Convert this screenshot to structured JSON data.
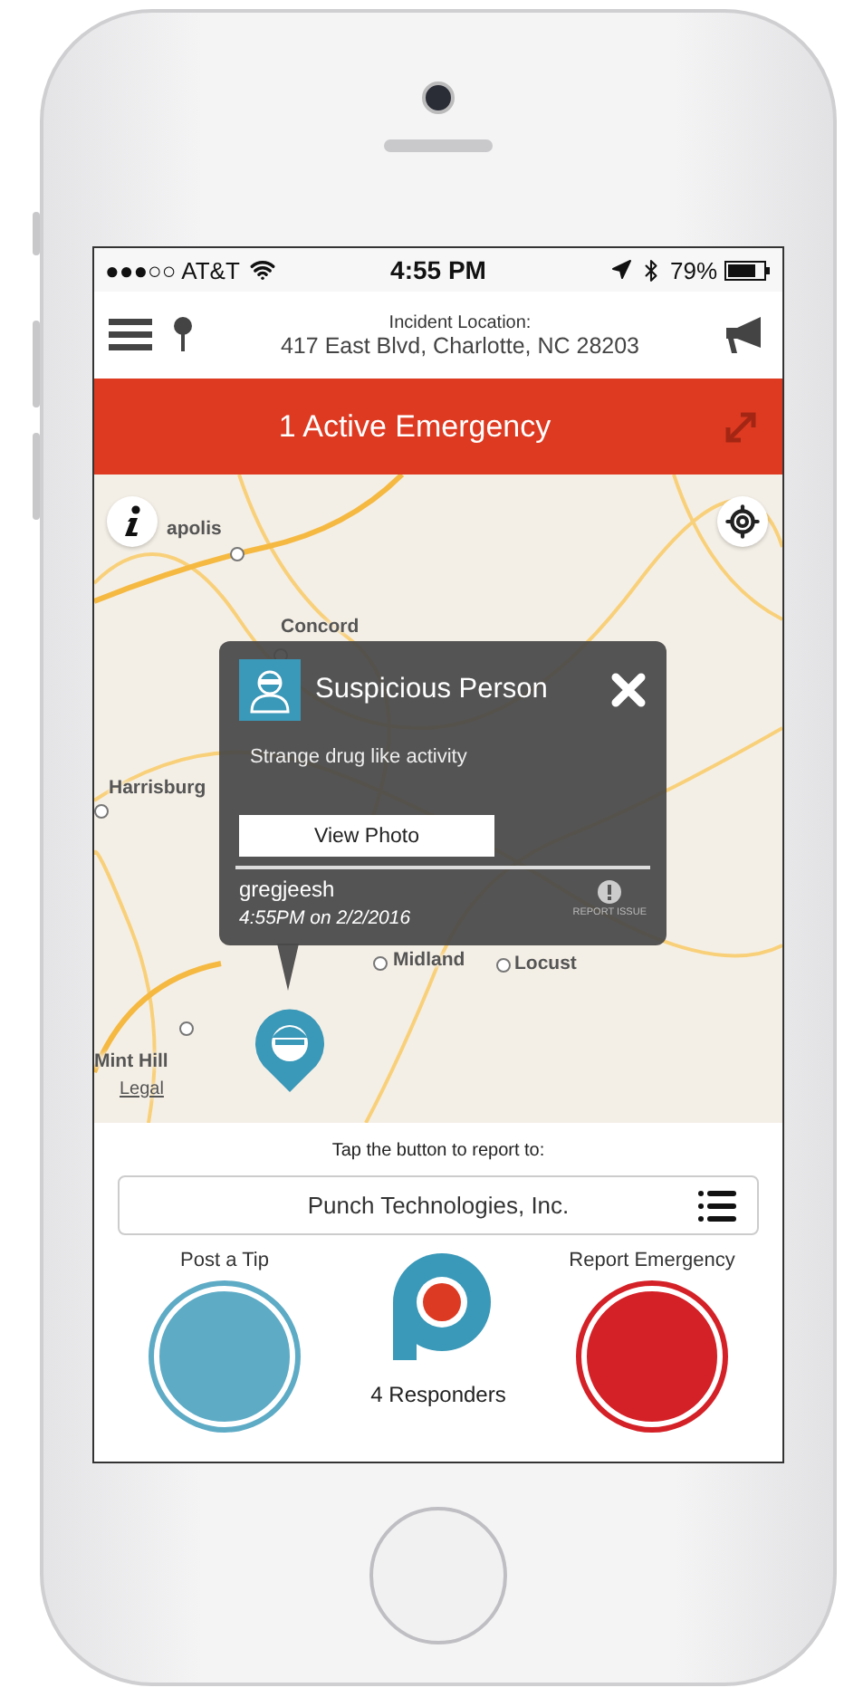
{
  "status_bar": {
    "carrier": "●●●○○ AT&T",
    "time": "4:55 PM",
    "battery": "79%"
  },
  "header": {
    "label": "Incident Location:",
    "address": "417 East Blvd, Charlotte, NC  28203"
  },
  "banner": {
    "title": "1 Active Emergency"
  },
  "map": {
    "labels": [
      {
        "text": "apolis"
      },
      {
        "text": "Concord"
      },
      {
        "text": "Harrisburg"
      },
      {
        "text": "Midland"
      },
      {
        "text": "Locust"
      },
      {
        "text": "Mint Hill"
      }
    ],
    "legal": "Legal"
  },
  "popup": {
    "title": "Suspicious Person",
    "description": "Strange drug like activity",
    "button": "View Photo",
    "user": "gregjeesh",
    "timestamp": "4:55PM on 2/2/2016",
    "report_label": "REPORT ISSUE"
  },
  "report": {
    "prompt": "Tap the button to report to:",
    "organization": "Punch Technologies, Inc.",
    "responders": "4 Responders",
    "actions": [
      {
        "kind": "tip",
        "label": "Post a Tip"
      },
      {
        "kind": "emergency",
        "label": "Report Emergency"
      }
    ]
  }
}
